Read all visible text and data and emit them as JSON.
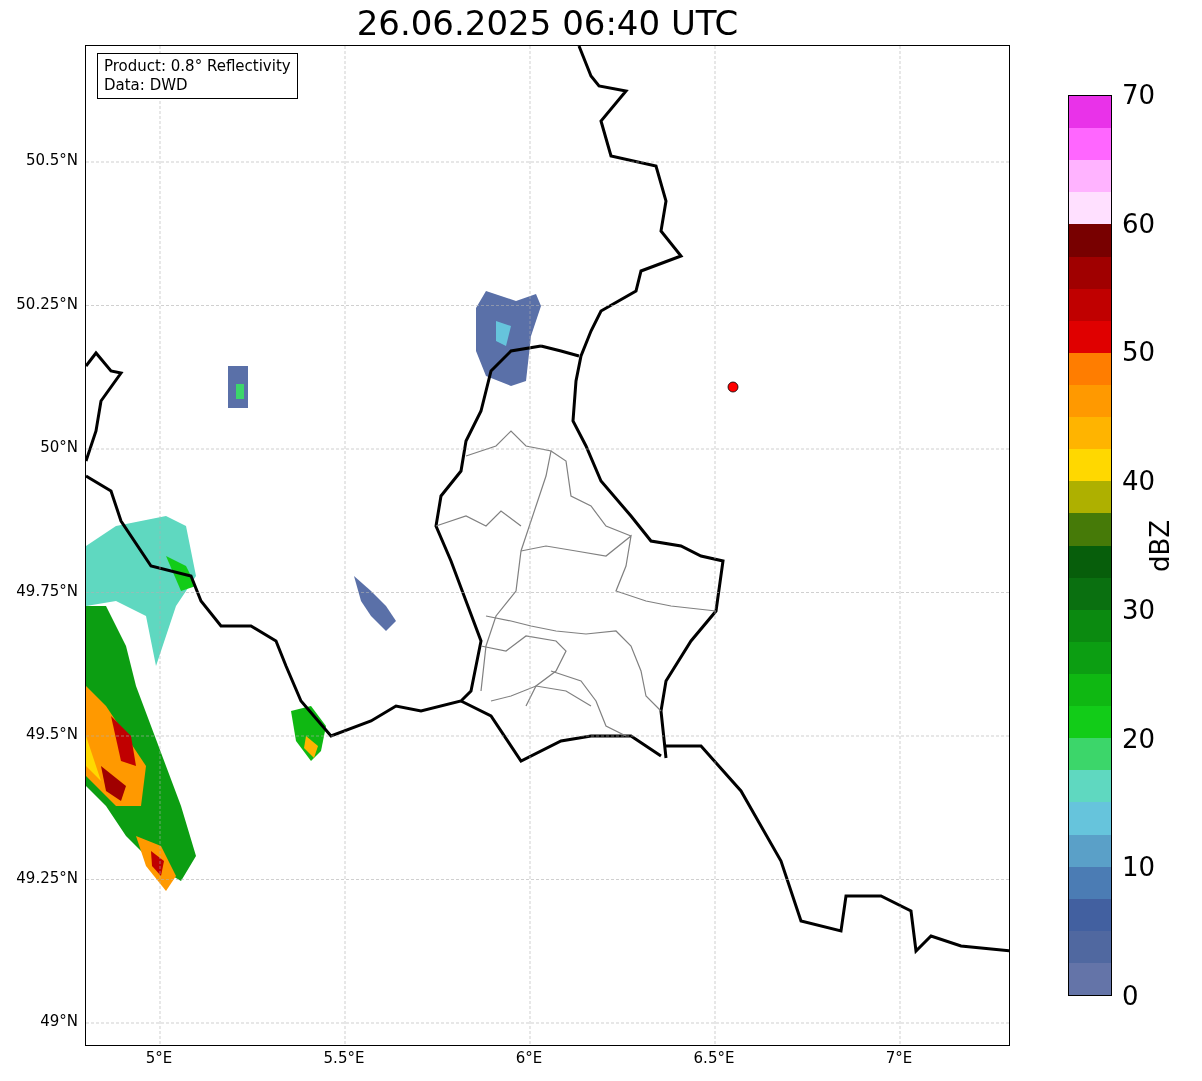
{
  "title": "26.06.2025 06:40 UTC",
  "info_box": [
    "Product: 0.8° Reflectivity",
    "Data: DWD"
  ],
  "x_ticks": [
    "5°E",
    "5.5°E",
    "6°E",
    "6.5°E",
    "7°E"
  ],
  "y_ticks": [
    "50.5°N",
    "50.25°N",
    "50°N",
    "49.75°N",
    "49.5°N",
    "49.25°N",
    "49°N"
  ],
  "colorbar": {
    "label": "dBZ",
    "ticks": [
      "70",
      "60",
      "50",
      "40",
      "30",
      "20",
      "10",
      "0"
    ],
    "segments": [
      {
        "color": "#e932e9"
      },
      {
        "color": "#ff66ff"
      },
      {
        "color": "#ffb3ff"
      },
      {
        "color": "#ffe0ff"
      },
      {
        "color": "#780000"
      },
      {
        "color": "#a00000"
      },
      {
        "color": "#c00000"
      },
      {
        "color": "#e00000"
      },
      {
        "color": "#ff7d00"
      },
      {
        "color": "#ff9900"
      },
      {
        "color": "#ffb400"
      },
      {
        "color": "#ffd800"
      },
      {
        "color": "#aeb000"
      },
      {
        "color": "#467a08"
      },
      {
        "color": "#075e0b"
      },
      {
        "color": "#0a7010"
      },
      {
        "color": "#0b8a10"
      },
      {
        "color": "#0c9e12"
      },
      {
        "color": "#0fb812"
      },
      {
        "color": "#12cc18"
      },
      {
        "color": "#3cd66a"
      },
      {
        "color": "#5fd8c0"
      },
      {
        "color": "#66c4dc"
      },
      {
        "color": "#5aa0c8"
      },
      {
        "color": "#4b7cb4"
      },
      {
        "color": "#4260a0"
      },
      {
        "color": "#5068a0"
      },
      {
        "color": "#6474a8"
      }
    ]
  }
}
